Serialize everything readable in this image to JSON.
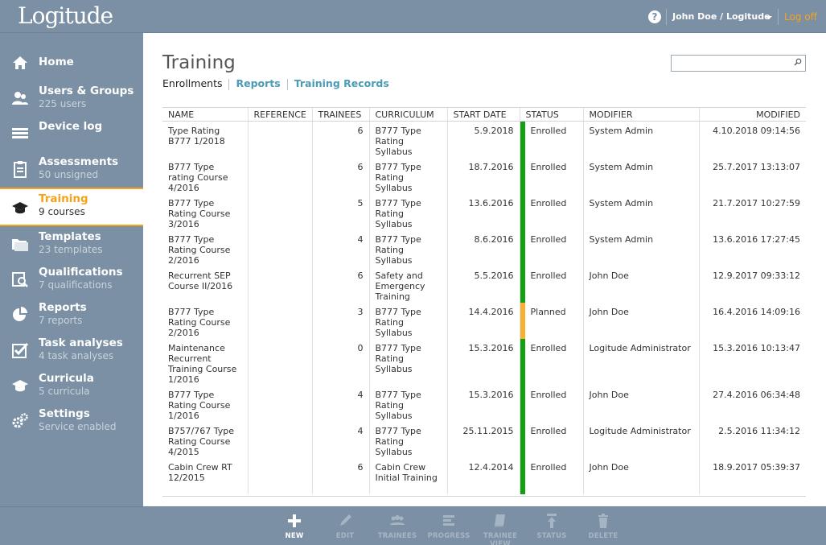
{
  "header": {
    "logo": "Logitude",
    "help_icon": "question-circle-icon",
    "user": "John Doe / Logitude",
    "logoff": "Log off"
  },
  "sidebar": {
    "items": [
      {
        "label": "Home",
        "sub": "",
        "icon": "home-icon"
      },
      {
        "label": "Users & Groups",
        "sub": "225 users",
        "icon": "users-icon"
      },
      {
        "label": "Device log",
        "sub": "",
        "icon": "list-icon"
      },
      {
        "label": "Assessments",
        "sub": "50 unsigned",
        "icon": "clipboard-icon"
      },
      {
        "label": "Training",
        "sub": "9 courses",
        "icon": "graduation-cap-icon",
        "active": true
      },
      {
        "label": "Templates",
        "sub": "23 templates",
        "icon": "folders-icon"
      },
      {
        "label": "Qualifications",
        "sub": "7 qualifications",
        "icon": "search-doc-icon"
      },
      {
        "label": "Reports",
        "sub": "7 reports",
        "icon": "pie-chart-icon"
      },
      {
        "label": "Task analyses",
        "sub": "4 task analyses",
        "icon": "checkbox-icon"
      },
      {
        "label": "Curricula",
        "sub": "5 curricula",
        "icon": "graduation-cap-icon"
      },
      {
        "label": "Settings",
        "sub": "Service enabled",
        "icon": "gears-icon"
      }
    ]
  },
  "main": {
    "title": "Training",
    "tabs": [
      {
        "label": "Enrollments",
        "current": true
      },
      {
        "label": "Reports"
      },
      {
        "label": "Training Records"
      }
    ],
    "search": {
      "value": "",
      "placeholder": ""
    },
    "columns": [
      "NAME",
      "REFERENCE",
      "TRAINEES",
      "CURRICULUM",
      "START DATE",
      "STATUS",
      "MODIFIER",
      "MODIFIED"
    ],
    "rows": [
      {
        "name": "Type Rating B777 1/2018",
        "reference": "",
        "trainees": "6",
        "curriculum": "B777 Type Rating Syllabus",
        "start_date": "5.9.2018",
        "status": "Enrolled",
        "status_color": "#12a012",
        "modifier": "System Admin",
        "modified": "4.10.2018 09:14:56"
      },
      {
        "name": "B777 Type rating Course 4/2016",
        "reference": "",
        "trainees": "6",
        "curriculum": "B777 Type Rating Syllabus",
        "start_date": "18.7.2016",
        "status": "Enrolled",
        "status_color": "#12a012",
        "modifier": "System Admin",
        "modified": "25.7.2017 13:13:07"
      },
      {
        "name": "B777 Type Rating Course 3/2016",
        "reference": "",
        "trainees": "5",
        "curriculum": "B777 Type Rating Syllabus",
        "start_date": "13.6.2016",
        "status": "Enrolled",
        "status_color": "#12a012",
        "modifier": "System Admin",
        "modified": "21.7.2017 10:27:59"
      },
      {
        "name": "B777 Type Rating Course 2/2016",
        "reference": "",
        "trainees": "4",
        "curriculum": "B777 Type Rating Syllabus",
        "start_date": "8.6.2016",
        "status": "Enrolled",
        "status_color": "#12a012",
        "modifier": "System Admin",
        "modified": "13.6.2016 17:27:45"
      },
      {
        "name": "Recurrent SEP Course II/2016",
        "reference": "",
        "trainees": "6",
        "curriculum": "Safety and Emergency Training",
        "start_date": "5.5.2016",
        "status": "Enrolled",
        "status_color": "#12a012",
        "modifier": "John Doe",
        "modified": "12.9.2017 09:33:12"
      },
      {
        "name": "B777 Type Rating Course 2/2016",
        "reference": "",
        "trainees": "3",
        "curriculum": "B777 Type Rating Syllabus",
        "start_date": "14.4.2016",
        "status": "Planned",
        "status_color": "#f7b030",
        "modifier": "John Doe",
        "modified": "16.4.2016 14:09:16"
      },
      {
        "name": "Maintenance Recurrent Training Course 1/2016",
        "reference": "",
        "trainees": "0",
        "curriculum": "B777 Type Rating Syllabus",
        "start_date": "15.3.2016",
        "status": "Enrolled",
        "status_color": "#12a012",
        "modifier": "Logitude Administrator",
        "modified": "15.3.2016 10:13:47"
      },
      {
        "name": "B777 Type Rating Course 1/2016",
        "reference": "",
        "trainees": "4",
        "curriculum": "B777 Type Rating Syllabus",
        "start_date": "15.3.2016",
        "status": "Enrolled",
        "status_color": "#12a012",
        "modifier": "John Doe",
        "modified": "27.4.2016 06:34:48"
      },
      {
        "name": "B757/767 Type Rating Course 4/2015",
        "reference": "",
        "trainees": "4",
        "curriculum": "B777 Type Rating Syllabus",
        "start_date": "25.11.2015",
        "status": "Enrolled",
        "status_color": "#12a012",
        "modifier": "Logitude Administrator",
        "modified": "2.5.2016 11:34:12"
      },
      {
        "name": "Cabin Crew RT 12/2015",
        "reference": "",
        "trainees": "6",
        "curriculum": "Cabin Crew Initial Training",
        "start_date": "12.4.2014",
        "status": "Enrolled",
        "status_color": "#12a012",
        "modifier": "John Doe",
        "modified": "18.9.2017 05:39:37"
      }
    ]
  },
  "toolbar": {
    "new": "NEW",
    "edit": "EDIT",
    "trainees": "TRAINEES",
    "progress": "PROGRESS",
    "trainee_view": "TRAINEE VIEW",
    "status": "STATUS",
    "delete": "DELETE"
  },
  "colors": {
    "accent": "#f7a21b",
    "link": "#4a9bb6",
    "chrome": "#7b90a4",
    "enrolled": "#12a012",
    "planned": "#f7b030"
  }
}
